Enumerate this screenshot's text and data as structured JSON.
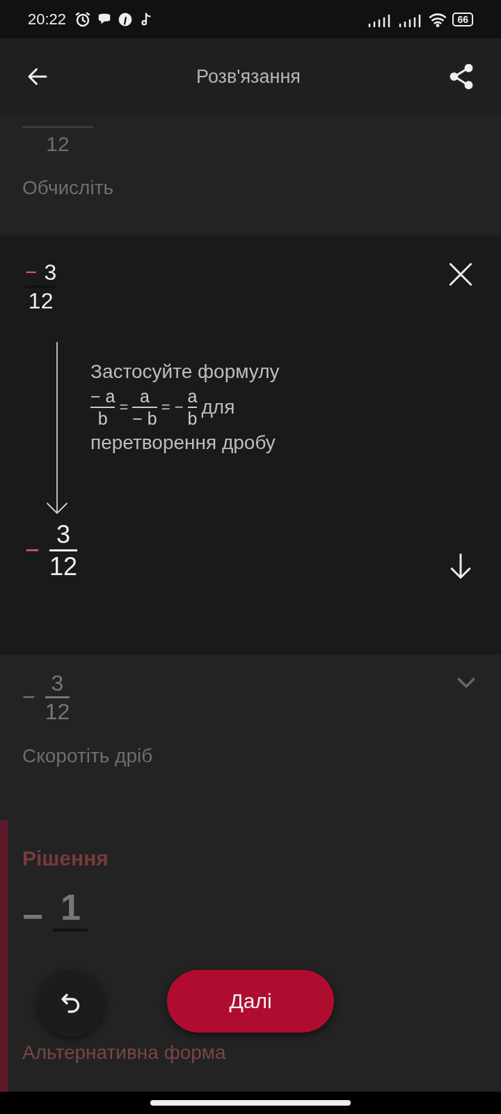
{
  "status_bar": {
    "time": "20:22",
    "battery": "66"
  },
  "header": {
    "title": "Розв'язання"
  },
  "previous_step": {
    "denominator": "12",
    "caption": "Обчисліть"
  },
  "current_step": {
    "expression": {
      "sign": {
        "text": "−",
        "highlighted": true
      },
      "numerator": "3",
      "denominator": "12"
    },
    "explanation": {
      "intro": "Застосуйте формулу",
      "formula": [
        {
          "kind": "fraction",
          "numerator": "− a",
          "denominator": "b"
        },
        {
          "kind": "symbol",
          "text": "="
        },
        {
          "kind": "fraction",
          "numerator": "a",
          "denominator": "− b"
        },
        {
          "kind": "symbol",
          "text": "= −"
        },
        {
          "kind": "fraction",
          "numerator": "a",
          "denominator": "b"
        }
      ],
      "after_formula": "для",
      "outro": "перетворення дробу"
    },
    "result": {
      "sign": {
        "text": "−",
        "highlighted": true
      },
      "numerator": "3",
      "denominator": "12"
    }
  },
  "next_step": {
    "expanded": false,
    "sign": {
      "text": "−",
      "highlighted": false
    },
    "numerator": "3",
    "denominator": "12",
    "caption": "Скоротіть дріб"
  },
  "solution": {
    "title": "Рішення",
    "sign": "−",
    "numerator": "1",
    "alternative_label": "Альтернативна форма"
  },
  "next_button": {
    "label": "Далі"
  }
}
